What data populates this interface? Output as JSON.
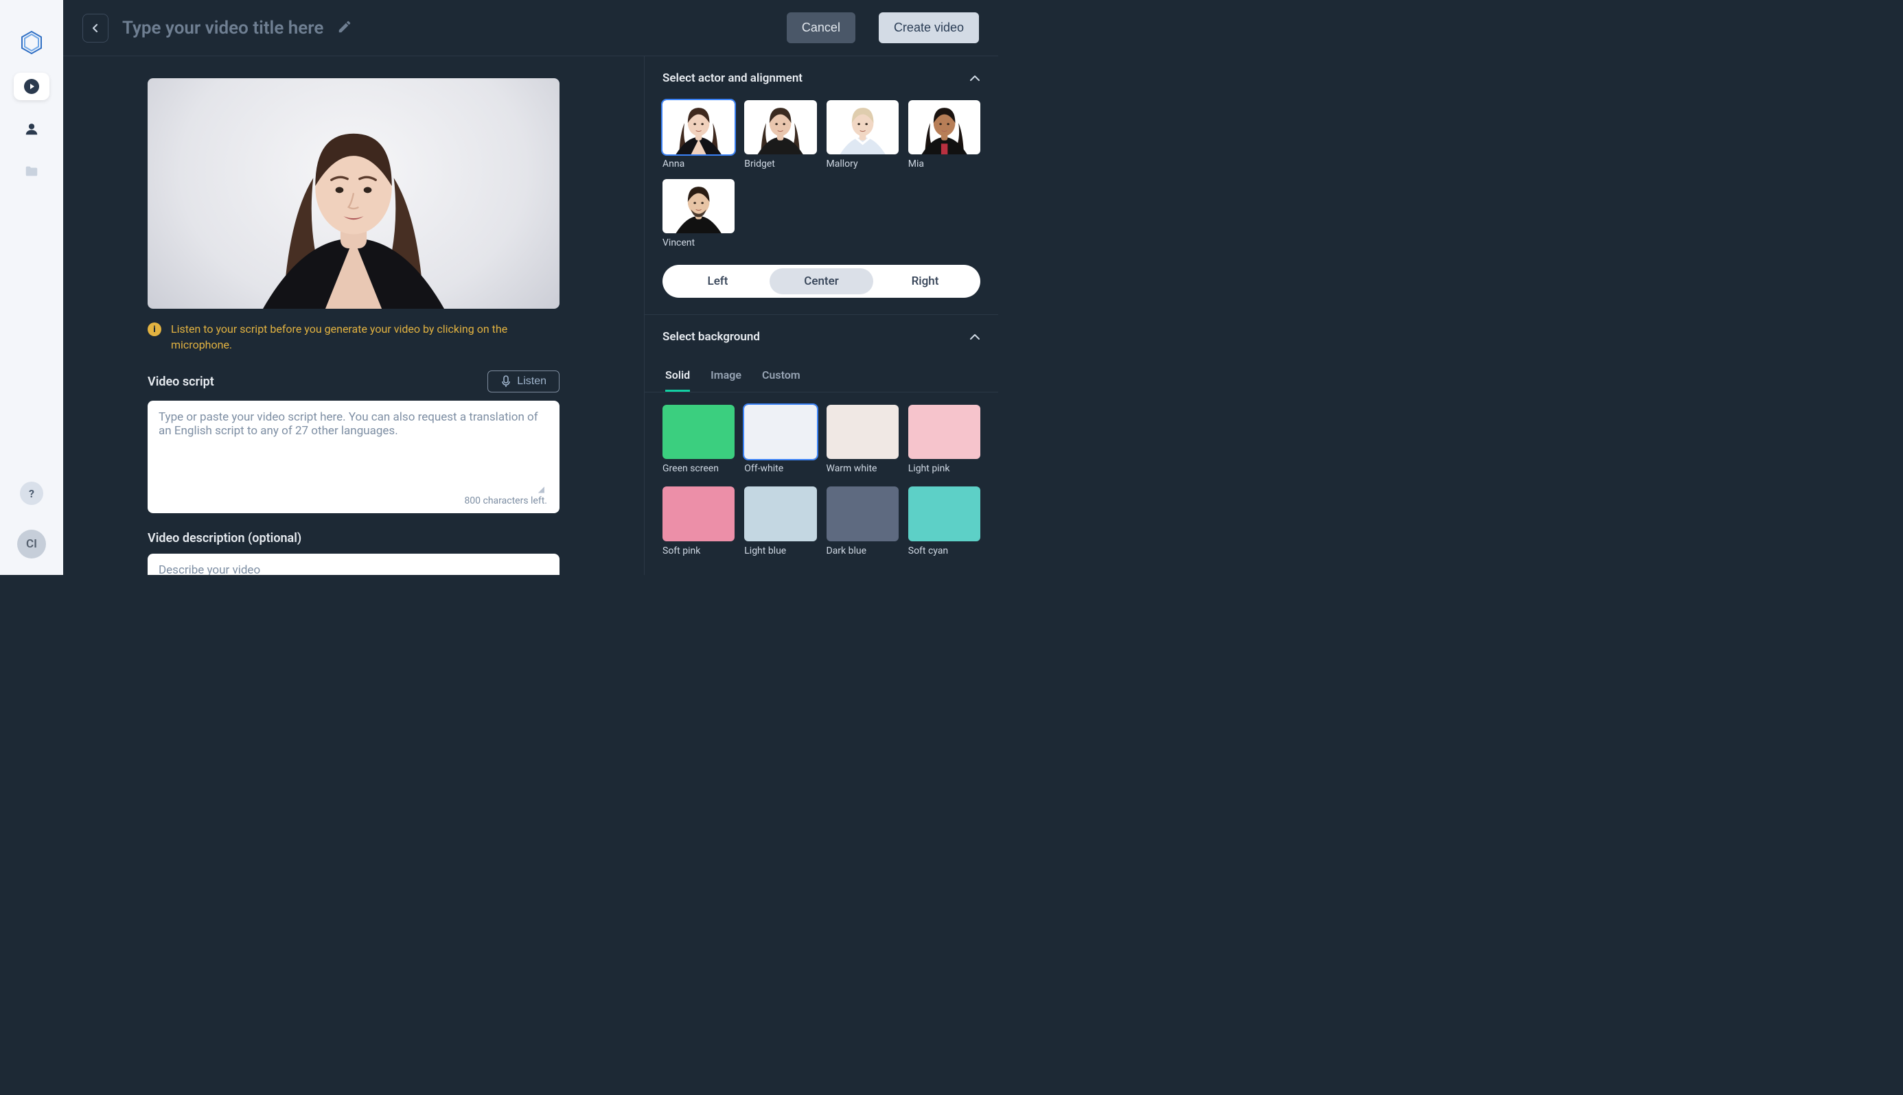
{
  "sidebar": {
    "nav": [
      {
        "name": "logo",
        "icon": "logo"
      },
      {
        "name": "videos",
        "icon": "play",
        "active": true
      },
      {
        "name": "actors",
        "icon": "user"
      },
      {
        "name": "files",
        "icon": "folder"
      }
    ],
    "help_label": "?",
    "avatar_initials": "CI"
  },
  "header": {
    "title_placeholder": "Type your video title here",
    "cancel_label": "Cancel",
    "create_label": "Create video"
  },
  "center": {
    "hint": "Listen to your script before you generate your video by clicking on the microphone.",
    "script_label": "Video script",
    "listen_label": "Listen",
    "script_placeholder": "Type or paste your video script here. You can also request a translation of an English script to any of 27 other languages.",
    "chars_left": "800 characters left.",
    "desc_label": "Video description (optional)",
    "desc_placeholder": "Describe your video"
  },
  "panel": {
    "actor_title": "Select actor and alignment",
    "actors": [
      {
        "name": "Anna",
        "selected": true,
        "svg": "anna"
      },
      {
        "name": "Bridget",
        "svg": "bridget"
      },
      {
        "name": "Mallory",
        "svg": "mallory"
      },
      {
        "name": "Mia",
        "svg": "mia"
      },
      {
        "name": "Vincent",
        "svg": "vincent"
      }
    ],
    "alignment": {
      "options": [
        "Left",
        "Center",
        "Right"
      ],
      "selected": "Center"
    },
    "bg_title": "Select background",
    "bg_tabs": [
      "Solid",
      "Image",
      "Custom"
    ],
    "bg_tab_selected": "Solid",
    "backgrounds": [
      {
        "name": "Green screen",
        "color": "#3bcf7f"
      },
      {
        "name": "Off-white",
        "color": "#eef1f6",
        "selected": true
      },
      {
        "name": "Warm white",
        "color": "#f0e8e4"
      },
      {
        "name": "Light pink",
        "color": "#f6c4cc"
      },
      {
        "name": "Soft pink",
        "color": "#ec8fa8"
      },
      {
        "name": "Light blue",
        "color": "#c4d7e2"
      },
      {
        "name": "Dark blue",
        "color": "#5e6a80"
      },
      {
        "name": "Soft cyan",
        "color": "#5dd0c7"
      }
    ]
  }
}
